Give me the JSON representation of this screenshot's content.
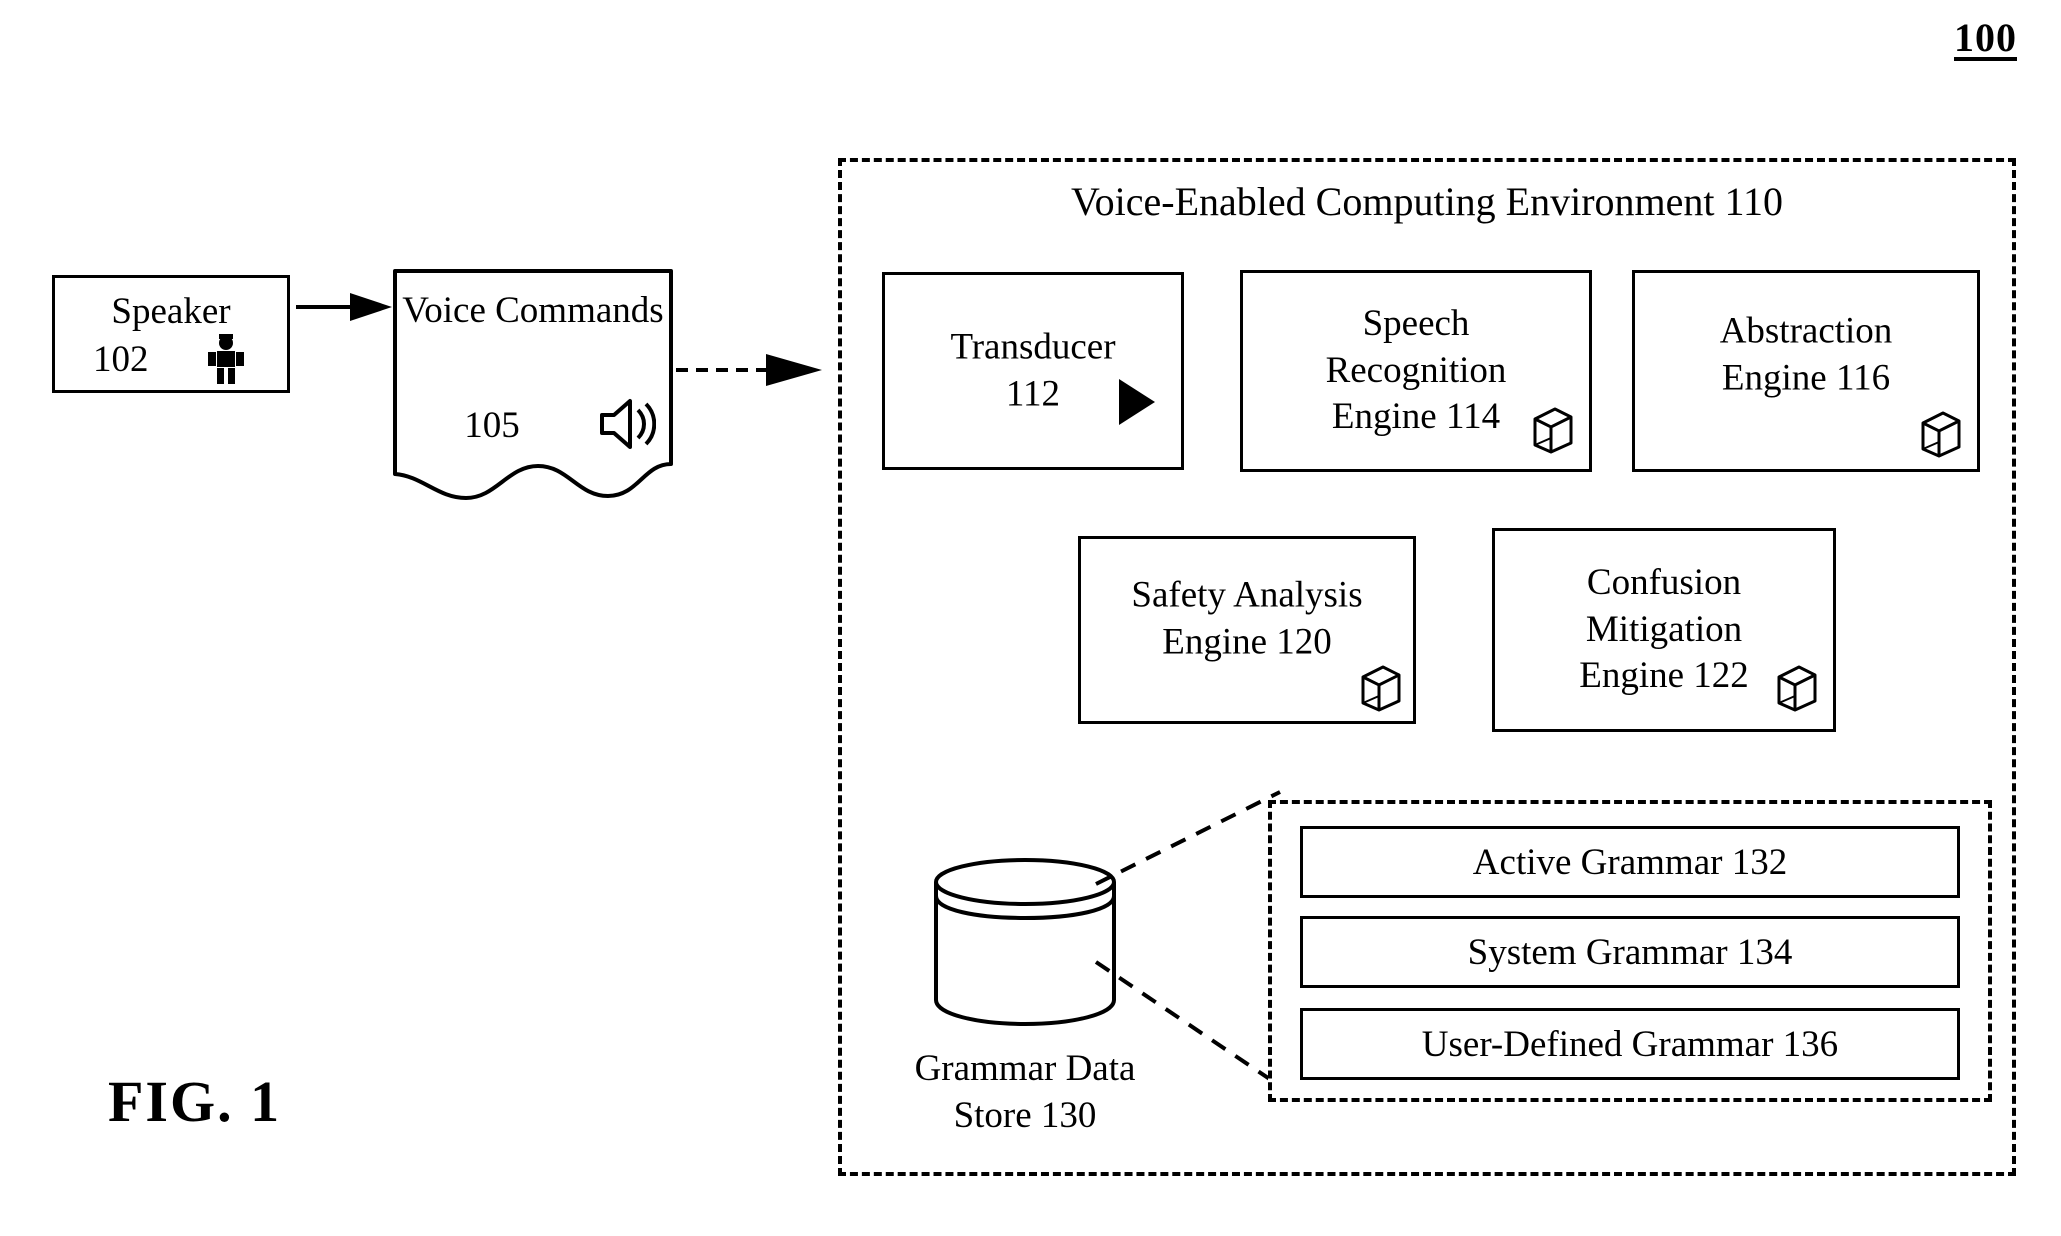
{
  "figure": {
    "number": "100",
    "caption": "FIG. 1"
  },
  "speaker": {
    "label": "Speaker",
    "number": "102",
    "icon": "person-icon"
  },
  "voice_commands": {
    "label": "Voice\nCommands",
    "number": "105",
    "icon": "sound-speaker-icon"
  },
  "arrows": [
    {
      "name": "speaker-to-voice-commands",
      "style": "solid"
    },
    {
      "name": "voice-commands-to-environment",
      "style": "dashed"
    }
  ],
  "environment": {
    "title": "Voice-Enabled Computing Environment 110",
    "engines": [
      {
        "id": "transducer",
        "text": "Transducer\n112",
        "icon": "play-triangle-icon"
      },
      {
        "id": "speech",
        "text": "Speech\nRecognition\nEngine 114",
        "icon": "cube-icon"
      },
      {
        "id": "abstraction",
        "text": "Abstraction\nEngine 116",
        "icon": "cube-icon"
      },
      {
        "id": "safety",
        "text": "Safety Analysis\nEngine 120",
        "icon": "cube-icon"
      },
      {
        "id": "confusion",
        "text": "Confusion\nMitigation\nEngine 122",
        "icon": "cube-icon"
      }
    ],
    "data_store": {
      "label": "Grammar Data\nStore 130",
      "icon": "database-cylinder-icon"
    },
    "grammars": [
      {
        "label": "Active Grammar 132"
      },
      {
        "label": "System Grammar 134"
      },
      {
        "label": "User-Defined Grammar 136"
      }
    ]
  },
  "colors": {
    "ink": "#000000",
    "paper": "#ffffff"
  }
}
